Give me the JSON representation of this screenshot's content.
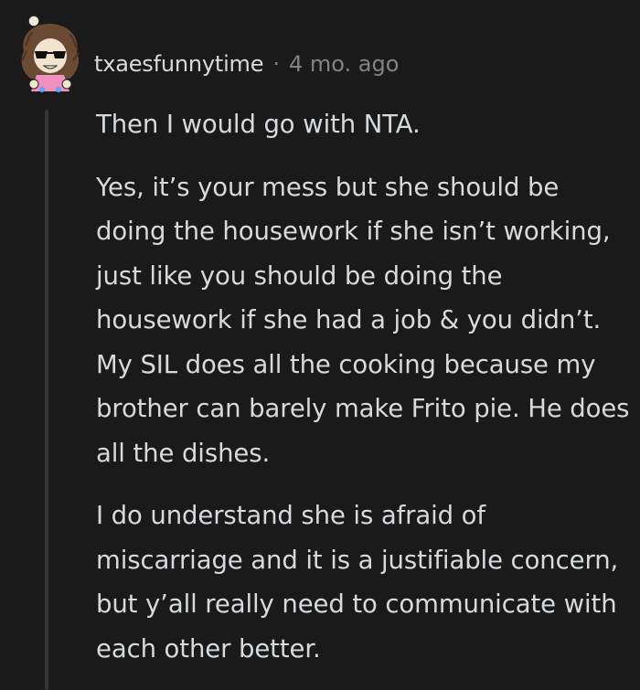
{
  "comment": {
    "author": "txaesfunnytime",
    "separator": "·",
    "age": "4 mo. ago",
    "avatar": "cartoon-avatar-curly-hair-sunglasses",
    "paragraphs": [
      "Then I would go with NTA.",
      "Yes, it’s your mess but she should be doing the housework if she isn’t working, just like you should be doing the housework if she had a job & you didn’t. My SIL does all the cooking because my brother can barely make Frito pie. He does all the dishes.",
      "I do understand she is afraid of miscarriage and it is a justifiable concern, but y’all really need to communicate with each other better."
    ]
  },
  "colors": {
    "background": "#1a1a1b",
    "text": "#d7dadc",
    "muted": "#818384",
    "thread_line": "#343536"
  }
}
